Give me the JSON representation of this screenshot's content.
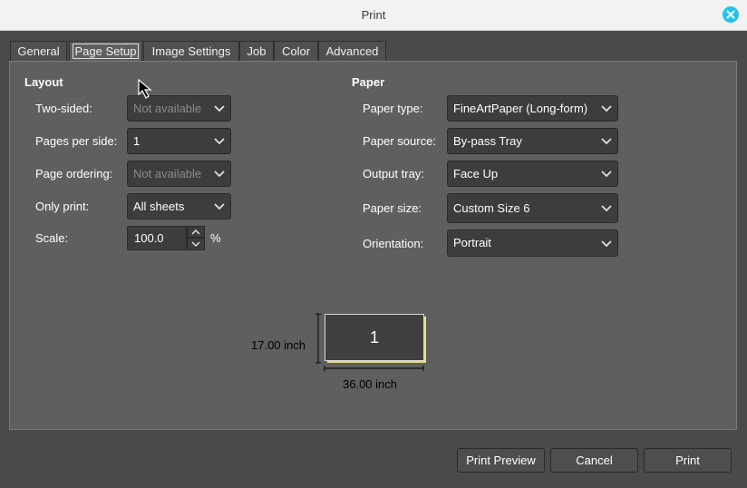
{
  "window": {
    "title": "Print"
  },
  "tabs": [
    {
      "label": "General"
    },
    {
      "label": "Page Setup"
    },
    {
      "label": "Image Settings"
    },
    {
      "label": "Job"
    },
    {
      "label": "Color"
    },
    {
      "label": "Advanced"
    }
  ],
  "active_tab": "Page Setup",
  "layout": {
    "title": "Layout",
    "two_sided": {
      "label": "Two-sided:",
      "value": "Not available",
      "enabled": false
    },
    "pages_per_side": {
      "label": "Pages per side:",
      "value": "1",
      "enabled": true
    },
    "page_ordering": {
      "label": "Page ordering:",
      "value": "Not available",
      "enabled": false
    },
    "only_print": {
      "label": "Only print:",
      "value": "All sheets",
      "enabled": true
    },
    "scale": {
      "label": "Scale:",
      "value": "100.0",
      "unit": "%"
    }
  },
  "paper": {
    "title": "Paper",
    "paper_type": {
      "label": "Paper type:",
      "value": "FineArtPaper (Long-form)"
    },
    "paper_source": {
      "label": "Paper source:",
      "value": "By-pass Tray"
    },
    "output_tray": {
      "label": "Output tray:",
      "value": "Face Up"
    },
    "paper_size": {
      "label": "Paper size:",
      "value": "Custom Size 6"
    },
    "orientation": {
      "label": "Orientation:",
      "value": "Portrait"
    }
  },
  "preview": {
    "page_number": "1",
    "height_label": "17.00 inch",
    "width_label": "36.00 inch"
  },
  "buttons": {
    "print_preview": "Print Preview",
    "cancel": "Cancel",
    "print": "Print"
  },
  "colors": {
    "accent_close": "#23c4e9",
    "preview_shadow": "#e8e27a"
  }
}
